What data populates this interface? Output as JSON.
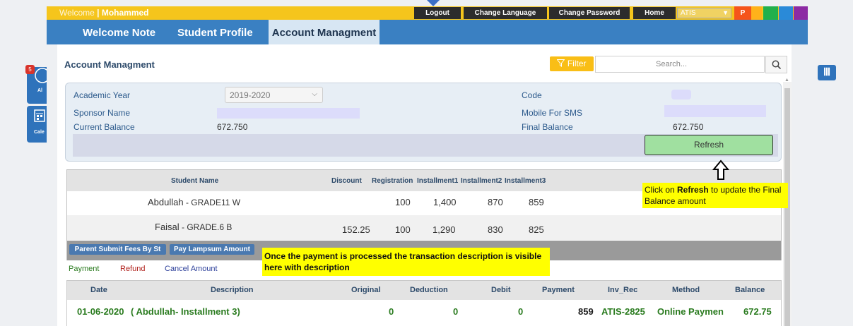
{
  "topbar": {
    "welcome_label": "Welcome",
    "welcome_user": "Mohammed",
    "logout": "Logout",
    "change_language": "Change Language",
    "change_password": "Change Password",
    "home": "Home",
    "school_select": "ATIS",
    "user_badge": "P",
    "swatches": [
      "#f5541b",
      "#22b04c",
      "#2a8ad8",
      "#8c2aa3"
    ]
  },
  "nav": {
    "tabs": [
      "Welcome Note",
      "Student Profile",
      "Account Managment"
    ]
  },
  "side": {
    "badge": "5",
    "widget1": "Al",
    "widget2": "Cale"
  },
  "page": {
    "title": "Account Managment",
    "filter_label": "Filter",
    "search_placeholder": "Search..."
  },
  "info": {
    "academic_year_label": "Academic Year",
    "academic_year_value": "2019-2020",
    "sponsor_name_label": "Sponsor Name",
    "current_balance_label": "Current Balance",
    "current_balance_value": "672.750",
    "code_label": "Code",
    "mobile_label": "Mobile For SMS",
    "final_balance_label": "Final Balance",
    "final_balance_value": "672.750",
    "refresh_label": "Refresh"
  },
  "students": {
    "headers": [
      "Student Name",
      "Discount",
      "Registration",
      "Installment1",
      "Installment2",
      "Installment3"
    ],
    "rows": [
      {
        "name": "Abdullah",
        "grade": " - GRADE11 W",
        "discount": "",
        "registration": "100",
        "inst1": "1,400",
        "inst2": "870",
        "inst3": "859"
      },
      {
        "name": "Faisal",
        "grade": " - GRADE.6 B",
        "discount": "152.25",
        "registration": "100",
        "inst1": "1,290",
        "inst2": "830",
        "inst3": "825"
      }
    ],
    "buttons": [
      "Parent Submit Fees By St",
      "Pay Lampsum Amount"
    ]
  },
  "notes": {
    "refresh_prefix": "Click on ",
    "refresh_bold": "Refresh",
    "refresh_rest": " to update the Final Balance amount",
    "payment": "Once the payment is processed the transaction description is visible here with description"
  },
  "links": {
    "payment": "Payment",
    "refund": "Refund",
    "cancel": "Cancel Amount"
  },
  "transactions": {
    "headers": [
      "Date",
      "Description",
      "Original",
      "Deduction",
      "Debit",
      "Payment",
      "Inv_Rec",
      "Method",
      "Balance"
    ],
    "rows": [
      {
        "date": "01-06-2020",
        "description": "( Abdullah- Installment 3)",
        "original": "0",
        "deduction": "0",
        "debit": "0",
        "payment": "859",
        "inv_rec": "ATIS-2825",
        "method": "Online Payment",
        "balance": "672.75"
      }
    ]
  },
  "colors": {
    "topbar": "#f5c51c",
    "nav": "#3a80c2",
    "active_tab": "#d7e6f3",
    "refresh": "#a0e0a0",
    "note": "#ffff00"
  }
}
